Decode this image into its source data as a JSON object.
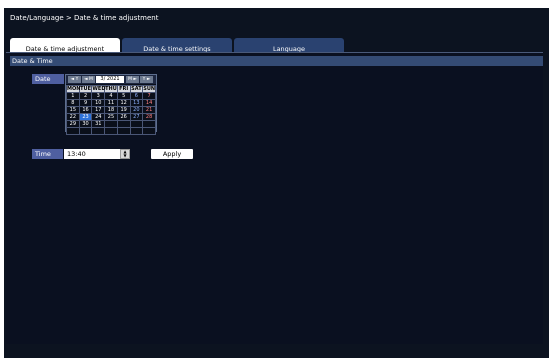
{
  "breadcrumb": "Date/Language > Date & time adjustment",
  "tabs": [
    {
      "label": "Date & time adjustment",
      "active": true
    },
    {
      "label": "Date & time settings",
      "active": false
    },
    {
      "label": "Language",
      "active": false
    }
  ],
  "section": {
    "title": "Date & Time"
  },
  "date": {
    "label": "Date",
    "nav": {
      "prev_year": "◄ Y",
      "prev_month": "◄ M",
      "month_display": "3/ 2021",
      "next_month": "M ►",
      "next_year": "Y ►"
    },
    "weekdays": [
      "MON",
      "TUE",
      "WED",
      "THU",
      "FRI",
      "SAT",
      "SUN"
    ],
    "weeks": [
      [
        "1",
        "2",
        "3",
        "4",
        "5",
        "6",
        "7"
      ],
      [
        "8",
        "9",
        "10",
        "11",
        "12",
        "13",
        "14"
      ],
      [
        "15",
        "16",
        "17",
        "18",
        "19",
        "20",
        "21"
      ],
      [
        "22",
        "23",
        "24",
        "25",
        "26",
        "27",
        "28"
      ],
      [
        "29",
        "30",
        "31",
        "",
        "",
        "",
        ""
      ],
      [
        "",
        "",
        "",
        "",
        "",
        "",
        ""
      ]
    ],
    "selected_day": "23"
  },
  "time": {
    "label": "Time",
    "value": "13:40"
  },
  "apply_label": "Apply",
  "colors": {
    "background": "#0c1320",
    "section_bar": "#344b74",
    "label_bg": "#4f5fa0",
    "tab_inactive": "#2a4270",
    "selected_day": "#2e72d8",
    "sunday_text": "#ff8080",
    "saturday_text": "#8fb3ff"
  }
}
